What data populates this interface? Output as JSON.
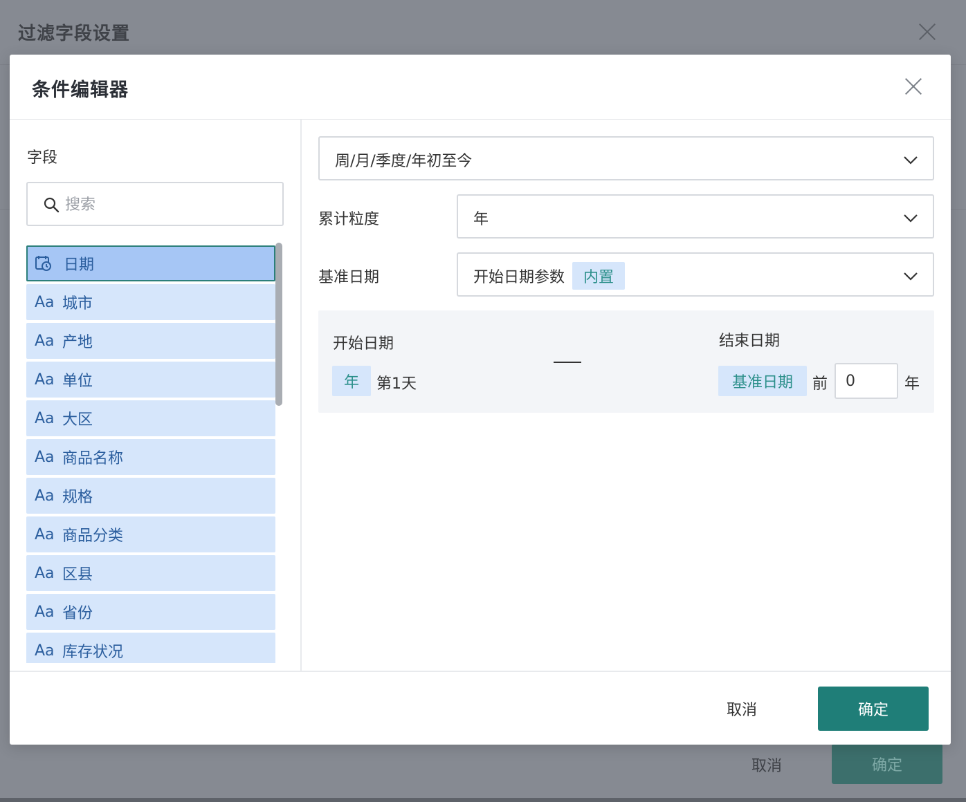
{
  "background_dialog": {
    "title": "过滤字段设置",
    "cancel_label": "取消",
    "ok_label": "确定"
  },
  "modal": {
    "title": "条件编辑器",
    "close_icon": "close-icon"
  },
  "left_panel": {
    "label": "字段",
    "search_placeholder": "搜索",
    "fields": [
      {
        "type_icon": "calendar-clock-icon",
        "name": "日期",
        "selected": true
      },
      {
        "type_icon": "Aa",
        "name": "城市"
      },
      {
        "type_icon": "Aa",
        "name": "产地"
      },
      {
        "type_icon": "Aa",
        "name": "单位"
      },
      {
        "type_icon": "Aa",
        "name": "大区"
      },
      {
        "type_icon": "Aa",
        "name": "商品名称"
      },
      {
        "type_icon": "Aa",
        "name": "规格"
      },
      {
        "type_icon": "Aa",
        "name": "商品分类"
      },
      {
        "type_icon": "Aa",
        "name": "区县"
      },
      {
        "type_icon": "Aa",
        "name": "省份"
      },
      {
        "type_icon": "Aa",
        "name": "库存状况"
      }
    ]
  },
  "right_panel": {
    "condition_type": "周/月/季度/年初至今",
    "granularity_label": "累计粒度",
    "granularity_value": "年",
    "base_date_label": "基准日期",
    "base_date_value": "开始日期参数",
    "base_date_tag": "内置",
    "range": {
      "start_label": "开始日期",
      "start_unit_tag": "年",
      "start_day": "第1天",
      "end_label": "结束日期",
      "end_base_tag": "基准日期",
      "end_before": "前",
      "end_offset": "0",
      "end_unit": "年"
    }
  },
  "footer": {
    "cancel_label": "取消",
    "ok_label": "确定"
  },
  "colors": {
    "accent": "#1f7e78",
    "field_bg": "#d6e6fb",
    "field_selected_bg": "#a6c6f5",
    "tag_text": "#2b8f8a"
  }
}
